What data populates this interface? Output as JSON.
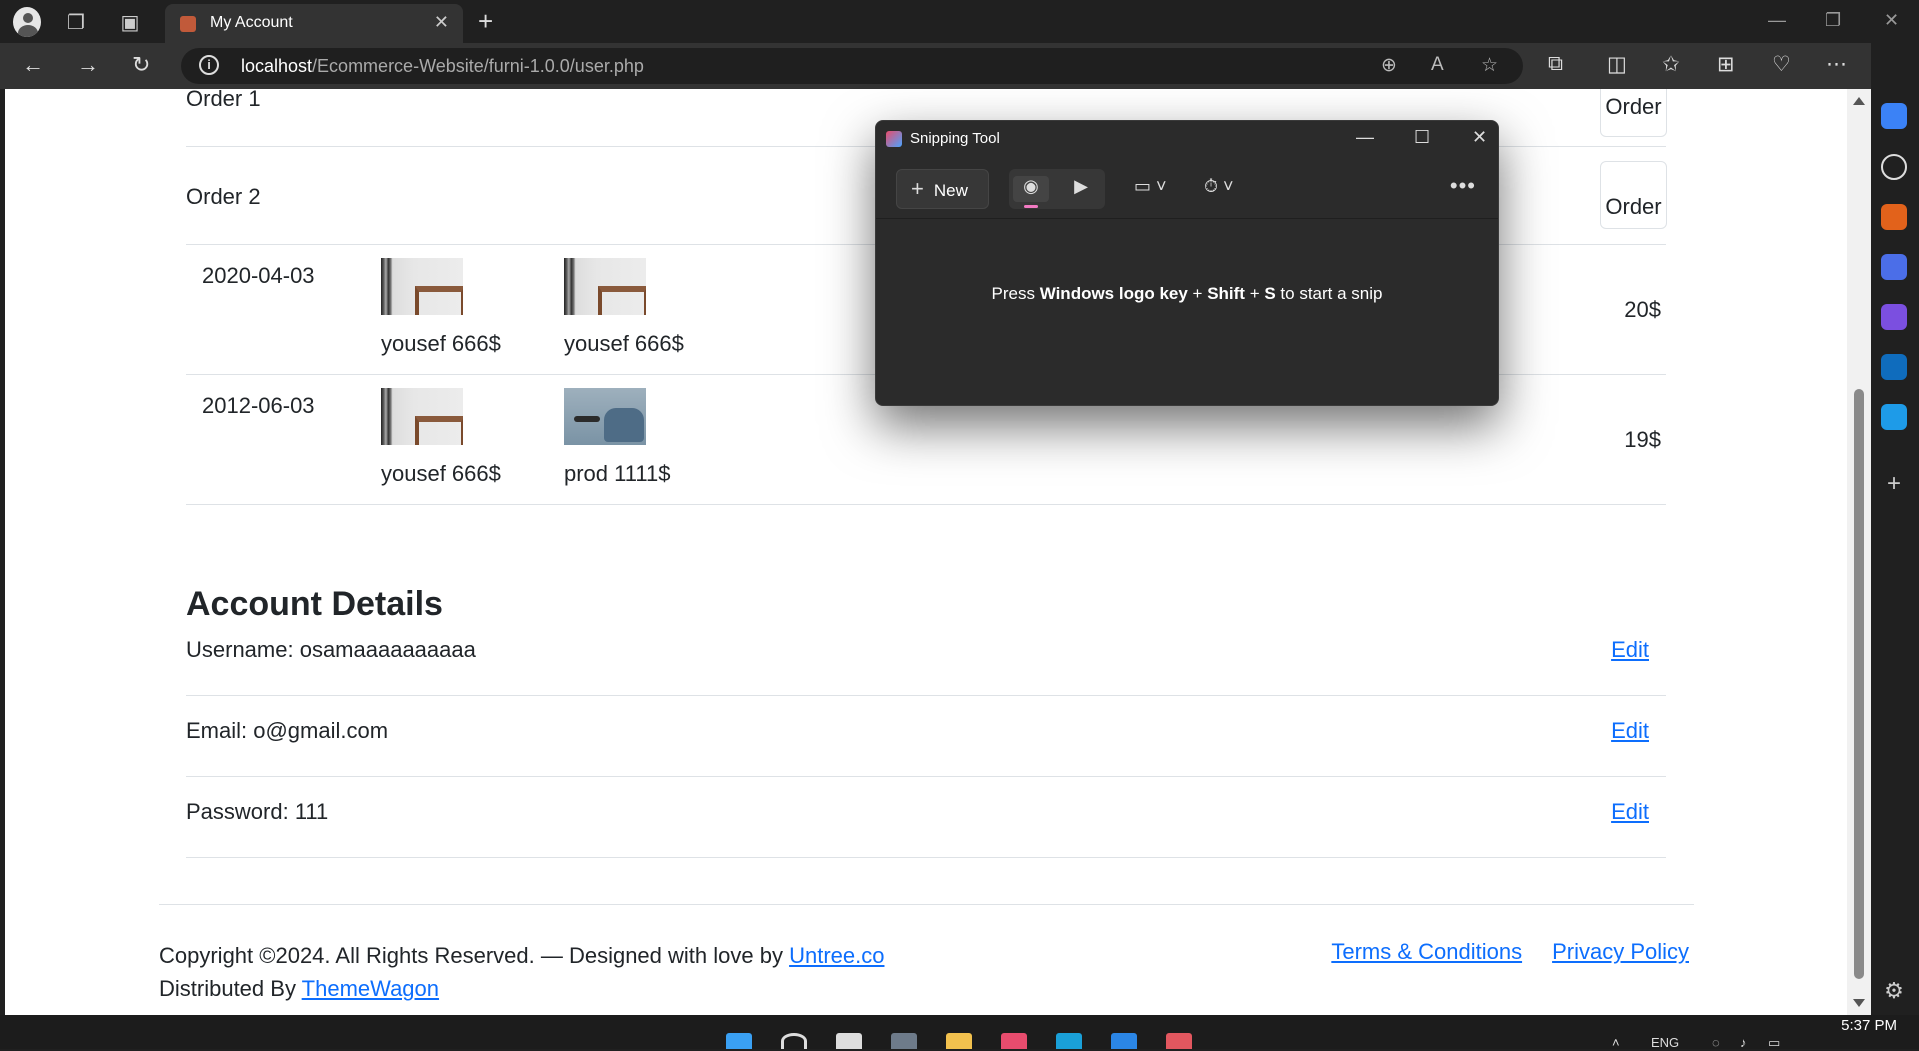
{
  "browser": {
    "tab_title": "My Account",
    "url_host": "localhost",
    "url_path": "/Ecommerce-Website/furni-1.0.0/user.php"
  },
  "orders": {
    "rows": [
      {
        "label": "Order 1",
        "img_alt": "Order"
      },
      {
        "label": "Order 2",
        "img_alt": "Order"
      }
    ],
    "details": [
      {
        "date": "2020-04-03",
        "products": [
          {
            "name": "yousef 666$",
            "img": "stool"
          },
          {
            "name": "yousef 666$",
            "img": "stool"
          }
        ],
        "total": "20$"
      },
      {
        "date": "2012-06-03",
        "products": [
          {
            "name": "yousef 666$",
            "img": "stool"
          },
          {
            "name": "prod 1111$",
            "img": "chair"
          }
        ],
        "total": "19$"
      }
    ]
  },
  "account": {
    "heading": "Account Details",
    "fields": [
      {
        "label": "Username: osamaaaaaaaaaa",
        "action": "Edit"
      },
      {
        "label": "Email: o@gmail.com",
        "action": "Edit"
      },
      {
        "label": "Password: 111",
        "action": "Edit"
      }
    ]
  },
  "footer": {
    "copyright": "Copyright ©2024. All Rights Reserved. — Designed with love by ",
    "designer_link": "Untree.co",
    "distributed": "Distributed By ",
    "distributor_link": "ThemeWagon",
    "terms": "Terms & Conditions",
    "privacy": "Privacy Policy"
  },
  "snipping_tool": {
    "title": "Snipping Tool",
    "new_label": "New",
    "hint_pre": "Press ",
    "hint_key1": "Windows logo key",
    "hint_plus1": " + ",
    "hint_key2": "Shift",
    "hint_plus2": " + ",
    "hint_key3": "S",
    "hint_post": " to start a snip"
  },
  "taskbar": {
    "time": "5:37 PM",
    "lang": "ENG"
  }
}
